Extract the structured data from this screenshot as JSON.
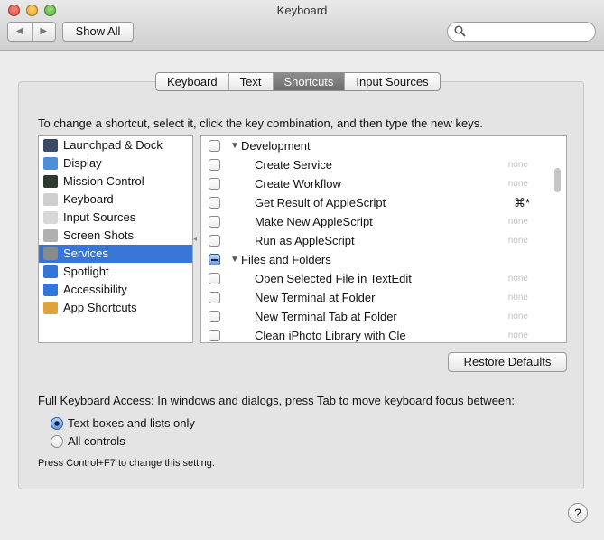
{
  "window": {
    "title": "Keyboard",
    "back_icon": "◀",
    "forward_icon": "▶",
    "show_all_label": "Show All",
    "search_value": "",
    "search_placeholder": "",
    "help_label": "?"
  },
  "tabs": [
    {
      "label": "Keyboard"
    },
    {
      "label": "Text"
    },
    {
      "label": "Shortcuts",
      "selected": true
    },
    {
      "label": "Input Sources"
    }
  ],
  "instruction": "To change a shortcut, select it, click the key combination, and then type the new keys.",
  "categories": [
    {
      "label": "Launchpad & Dock",
      "icon": "launchpad-dock-icon",
      "color": "#3a4a66"
    },
    {
      "label": "Display",
      "icon": "display-icon",
      "color": "#4a8fd8"
    },
    {
      "label": "Mission Control",
      "icon": "mission-control-icon",
      "color": "#2f3a30"
    },
    {
      "label": "Keyboard",
      "icon": "keyboard-icon",
      "color": "#cfcfcf"
    },
    {
      "label": "Input Sources",
      "icon": "input-sources-icon",
      "color": "#d8d8d8"
    },
    {
      "label": "Screen Shots",
      "icon": "screen-shots-icon",
      "color": "#b0b0b0"
    },
    {
      "label": "Services",
      "icon": "services-gear-icon",
      "color": "#8a8a8a",
      "selected": true
    },
    {
      "label": "Spotlight",
      "icon": "spotlight-icon",
      "color": "#2f78d8"
    },
    {
      "label": "Accessibility",
      "icon": "accessibility-icon",
      "color": "#2f78d8"
    },
    {
      "label": "App Shortcuts",
      "icon": "app-shortcuts-icon",
      "color": "#e0a23a"
    }
  ],
  "shortcuts": [
    {
      "type": "group",
      "label": "Development",
      "state": "unchecked"
    },
    {
      "type": "item",
      "label": "Create Service",
      "key": "none"
    },
    {
      "type": "item",
      "label": "Create Workflow",
      "key": "none"
    },
    {
      "type": "item",
      "label": "Get Result of AppleScript",
      "key": "⌘*",
      "key_set": true
    },
    {
      "type": "item",
      "label": "Make New AppleScript",
      "key": "none"
    },
    {
      "type": "item",
      "label": "Run as AppleScript",
      "key": "none"
    },
    {
      "type": "group",
      "label": "Files and Folders",
      "state": "mixed"
    },
    {
      "type": "item",
      "label": "Open Selected File in TextEdit",
      "key": "none"
    },
    {
      "type": "item",
      "label": "New Terminal at Folder",
      "key": "none"
    },
    {
      "type": "item",
      "label": "New Terminal Tab at Folder",
      "key": "none"
    },
    {
      "type": "item",
      "label": "Clean iPhoto Library with Cle",
      "key": "none"
    }
  ],
  "restore_defaults_label": "Restore Defaults",
  "full_keyboard_access": {
    "label": "Full Keyboard Access: In windows and dialogs, press Tab to move keyboard focus between:",
    "options": [
      {
        "label": "Text boxes and lists only",
        "selected": true
      },
      {
        "label": "All controls",
        "selected": false
      }
    ],
    "hint": "Press Control+F7 to change this setting."
  }
}
